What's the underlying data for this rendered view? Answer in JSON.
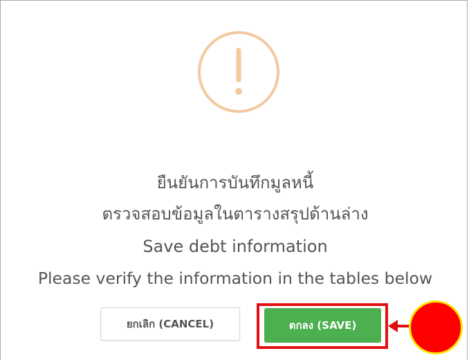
{
  "dialog": {
    "icon": "exclamation-warning-icon",
    "messages": {
      "thai_title": "ยืนยันการบันทึกมูลหนี้",
      "thai_subtitle": "ตรวจสอบข้อมูลในตารางสรุปด้านล่าง",
      "english_title": "Save debt information",
      "english_subtitle": "Please verify the information in the tables below"
    },
    "buttons": {
      "cancel_label": "ยกเลิก (CANCEL)",
      "save_label": "ตกลง (SAVE)"
    }
  },
  "colors": {
    "warning_icon": "#f3c9a0",
    "save_button": "#4caf50",
    "highlight": "#e01010",
    "marker_fill": "#ff0000",
    "marker_ring": "#ffe600"
  }
}
